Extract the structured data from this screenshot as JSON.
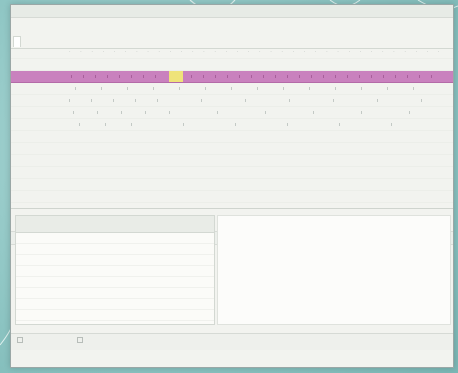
{
  "window": {
    "title": "",
    "tabs": [
      {
        "label": "",
        "active": true
      }
    ]
  },
  "grid": {
    "rows": [
      {
        "label": "",
        "highlighted": false
      },
      {
        "label": "",
        "highlighted": false
      },
      {
        "label": "",
        "highlighted": true
      },
      {
        "label": "",
        "highlighted": false
      },
      {
        "label": "",
        "highlighted": false
      },
      {
        "label": "",
        "highlighted": false
      },
      {
        "label": "",
        "highlighted": false
      },
      {
        "label": "",
        "highlighted": false
      },
      {
        "label": "",
        "highlighted": false
      },
      {
        "label": "",
        "highlighted": false
      },
      {
        "label": "",
        "highlighted": false
      },
      {
        "label": "",
        "highlighted": false
      },
      {
        "label": "",
        "highlighted": false
      }
    ],
    "axis_label": ""
  },
  "table": {
    "headers": [
      "",
      "",
      "",
      "",
      "",
      "",
      ""
    ],
    "rows": [
      [
        "",
        "",
        "",
        "",
        "",
        "",
        ""
      ],
      [
        "",
        "",
        "",
        "",
        "",
        "",
        ""
      ],
      [
        "",
        "",
        "",
        "",
        "",
        "",
        ""
      ],
      [
        "",
        "",
        "",
        "",
        "",
        "",
        ""
      ],
      [
        "",
        "",
        "",
        "",
        "",
        "",
        ""
      ],
      [
        "",
        "",
        "",
        "",
        "",
        "",
        ""
      ],
      [
        "",
        "",
        "",
        "",
        "",
        "",
        ""
      ],
      [
        "",
        "",
        "",
        "",
        "",
        "",
        ""
      ]
    ]
  },
  "footer": {
    "buttons": [
      {
        "label": ""
      },
      {
        "label": ""
      }
    ]
  },
  "colors": {
    "background": "#8fc6c4",
    "highlight_row": "#c981be",
    "highlight_cell": "#efe37a"
  }
}
